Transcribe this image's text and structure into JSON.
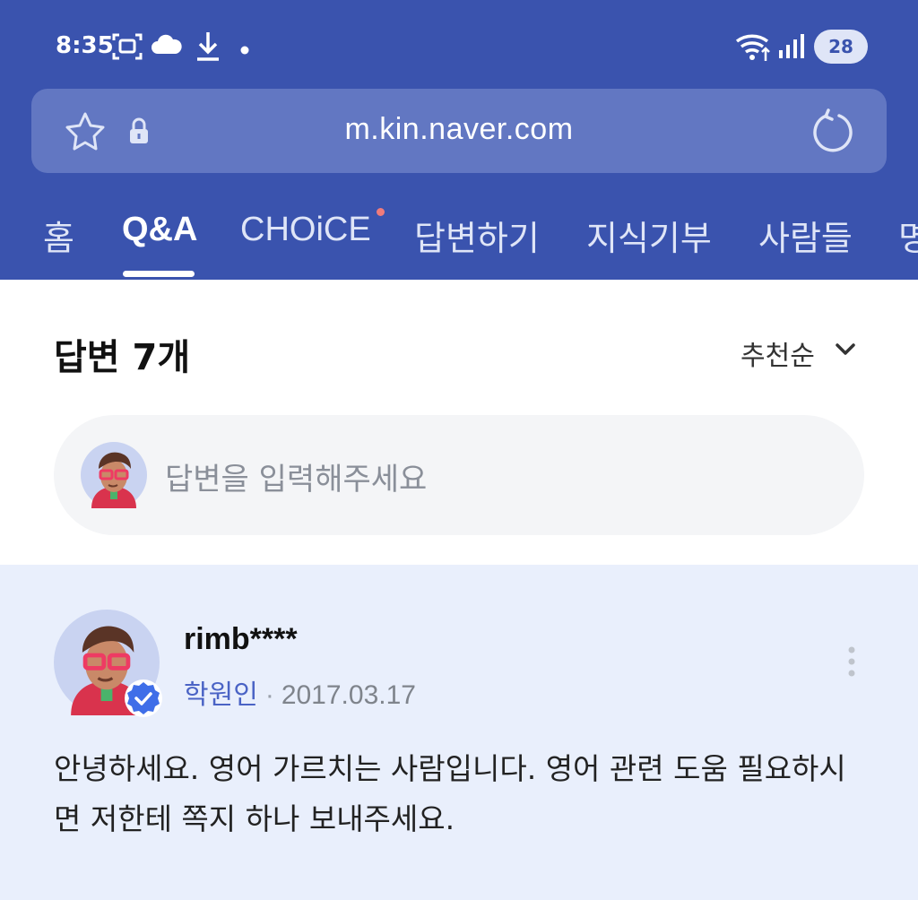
{
  "status_bar": {
    "time": "8:35",
    "battery": "28",
    "icons": [
      "screenshot-icon",
      "cloud-icon",
      "download-icon",
      "dot-icon",
      "wifi-icon",
      "signal-icon"
    ]
  },
  "browser": {
    "url": "m.kin.naver.com",
    "icons": [
      "star-icon",
      "lock-icon",
      "reload-icon"
    ]
  },
  "nav": {
    "tabs": [
      {
        "label": "홈"
      },
      {
        "label": "Q&A"
      },
      {
        "label": "CHOiCE"
      },
      {
        "label": "답변하기"
      },
      {
        "label": "지식기부"
      },
      {
        "label": "사람들"
      },
      {
        "label": "명"
      }
    ],
    "active_tab": "Q&A"
  },
  "answers": {
    "title": "답변 7개",
    "sort_label": "추천순",
    "input_placeholder": "답변을 입력해주세요"
  },
  "answer": {
    "username": "rimb****",
    "role": "학원인",
    "separator": "·",
    "date": "2017.03.17",
    "body": "안녕하세요. 영어 가르치는 사람입니다. 영어 관련 도움 필요하시면 저한테 쪽지 하나 보내주세요."
  },
  "colors": {
    "header_bg": "#3a53ae",
    "urlbar_bg": "#6277c2",
    "answer_bg": "#e9effc",
    "accent": "#4a63c5"
  }
}
